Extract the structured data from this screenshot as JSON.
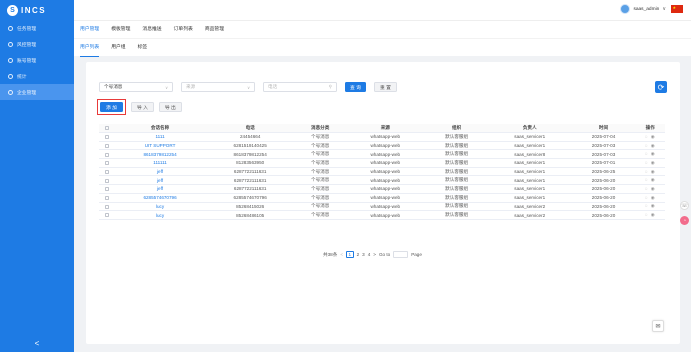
{
  "logo": {
    "initial": "S",
    "text": "INCS"
  },
  "sidebar": {
    "items": [
      {
        "label": "任务管理"
      },
      {
        "label": "风控管理"
      },
      {
        "label": "账号管理"
      },
      {
        "label": "统计"
      },
      {
        "label": "企业管理"
      }
    ],
    "collapse_label": "<"
  },
  "header": {
    "username": "saas_admin",
    "chevron": "∨"
  },
  "topnav": {
    "items": [
      {
        "label": "用户管理"
      },
      {
        "label": "模板管理"
      },
      {
        "label": "消息推送"
      },
      {
        "label": "订单列表"
      },
      {
        "label": "商品管理"
      }
    ]
  },
  "subtabs": {
    "items": [
      {
        "label": "用户列表"
      },
      {
        "label": "用户组"
      },
      {
        "label": "标签"
      }
    ]
  },
  "filters": {
    "msg_type": "个号消息",
    "select2_placeholder": "来源",
    "search_placeholder": "电话",
    "search_btn": "查 询",
    "reset_btn": "重 置"
  },
  "actions": {
    "add": "添 加",
    "import": "导 入",
    "export": "导 出"
  },
  "table": {
    "headers": [
      "会话名称",
      "电话",
      "消息分类",
      "来源",
      "组织",
      "负责人",
      "时间",
      "操作"
    ],
    "rows": [
      {
        "name": "1111",
        "phone": "24454664",
        "category": "个号消息",
        "source": "whatsapp-web",
        "org": "默认客服组",
        "owner": "saas_servicer1",
        "time": "2025-07-04"
      },
      {
        "name": "UIT SUPPORT",
        "phone": "6281519140425",
        "category": "个号消息",
        "source": "whatsapp-web",
        "org": "默认客服组",
        "owner": "saas_servicer1",
        "time": "2025-07-03"
      },
      {
        "name": "8618379812254",
        "phone": "8618379812254",
        "category": "个号消息",
        "source": "whatsapp-web",
        "org": "默认客服组",
        "owner": "saas_servicer8",
        "time": "2025-07-03"
      },
      {
        "name": "111111",
        "phone": "81283563950",
        "category": "个号消息",
        "source": "whatsapp-web",
        "org": "默认客服组",
        "owner": "saas_servicer1",
        "time": "2025-07-01"
      },
      {
        "name": "jeff",
        "phone": "6287722111631",
        "category": "个号消息",
        "source": "whatsapp-web",
        "org": "默认客服组",
        "owner": "saas_servicer1",
        "time": "2025-06-25"
      },
      {
        "name": "jeff",
        "phone": "6287722111631",
        "category": "个号消息",
        "source": "whatsapp-web",
        "org": "默认客服组",
        "owner": "saas_servicer1",
        "time": "2025-06-20"
      },
      {
        "name": "jeff",
        "phone": "6287722111631",
        "category": "个号消息",
        "source": "whatsapp-web",
        "org": "默认客服组",
        "owner": "saas_servicer1",
        "time": "2025-06-20"
      },
      {
        "name": "6285574670796",
        "phone": "6285574670796",
        "category": "个号消息",
        "source": "whatsapp-web",
        "org": "默认客服组",
        "owner": "saas_servicer1",
        "time": "2025-06-20"
      },
      {
        "name": "lucy",
        "phone": "85268415026",
        "category": "个号消息",
        "source": "whatsapp-web",
        "org": "默认客服组",
        "owner": "saas_servicer2",
        "time": "2025-06-20"
      },
      {
        "name": "lucy",
        "phone": "85268486105",
        "category": "个号消息",
        "source": "whatsapp-web",
        "org": "默认客服组",
        "owner": "saas_servicer2",
        "time": "2025-06-20"
      }
    ]
  },
  "pagination": {
    "total": "共38条",
    "prev": "<",
    "pages": [
      "1",
      "2",
      "3",
      "4"
    ],
    "next": ">",
    "goto_label": "Go to",
    "page_label": "Page"
  },
  "colors": {
    "primary": "#1e7be4",
    "highlight": "#e83a3a"
  },
  "icons": {
    "refresh": "refresh-icon",
    "chat": "chat-icon",
    "view": "eye-icon"
  }
}
